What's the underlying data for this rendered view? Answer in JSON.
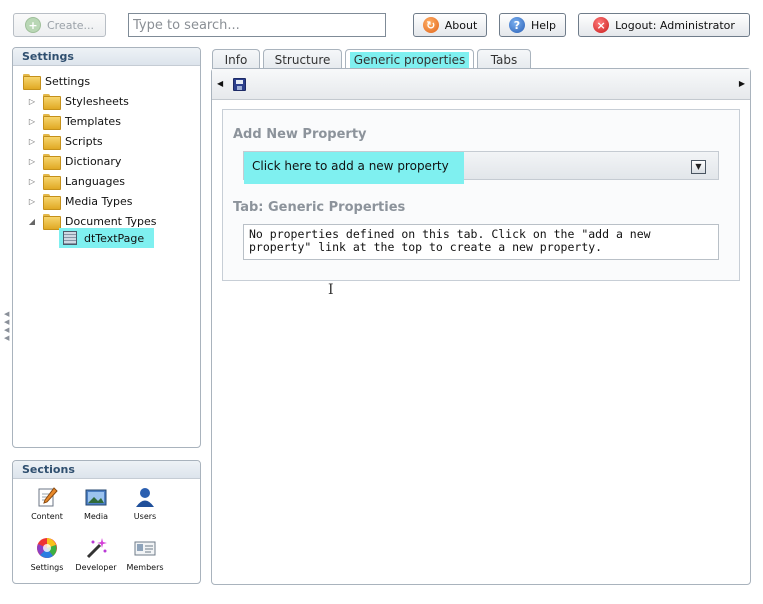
{
  "toolbar": {
    "create_label": "Create...",
    "search_placeholder": "Type to search...",
    "about_label": "About",
    "help_label": "Help",
    "logout_label": "Logout: Administrator"
  },
  "tree": {
    "title": "Settings",
    "root": "Settings",
    "items": [
      {
        "label": "Stylesheets"
      },
      {
        "label": "Templates"
      },
      {
        "label": "Scripts"
      },
      {
        "label": "Dictionary"
      },
      {
        "label": "Languages"
      },
      {
        "label": "Media Types"
      },
      {
        "label": "Document Types"
      }
    ],
    "child": "dtTextPage"
  },
  "sections": {
    "title": "Sections",
    "items": [
      {
        "label": "Content",
        "icon": "pencil-document-icon"
      },
      {
        "label": "Media",
        "icon": "picture-icon"
      },
      {
        "label": "Users",
        "icon": "user-icon"
      },
      {
        "label": "Settings",
        "icon": "color-wheel-icon"
      },
      {
        "label": "Developer",
        "icon": "magic-wand-icon"
      },
      {
        "label": "Members",
        "icon": "member-card-icon"
      }
    ]
  },
  "tabs": [
    {
      "label": "Info"
    },
    {
      "label": "Structure"
    },
    {
      "label": "Generic properties",
      "active": true
    },
    {
      "label": "Tabs"
    }
  ],
  "content": {
    "add_heading": "Add New Property",
    "add_link": "Click here to add a new property",
    "tab_heading": "Tab: Generic Properties",
    "empty_message": "No properties defined on this tab. Click on the \"add a new property\" link at the top to create a new property."
  },
  "colors": {
    "highlight": "#7ff0f0",
    "panel_title": "#2f4f6f"
  }
}
